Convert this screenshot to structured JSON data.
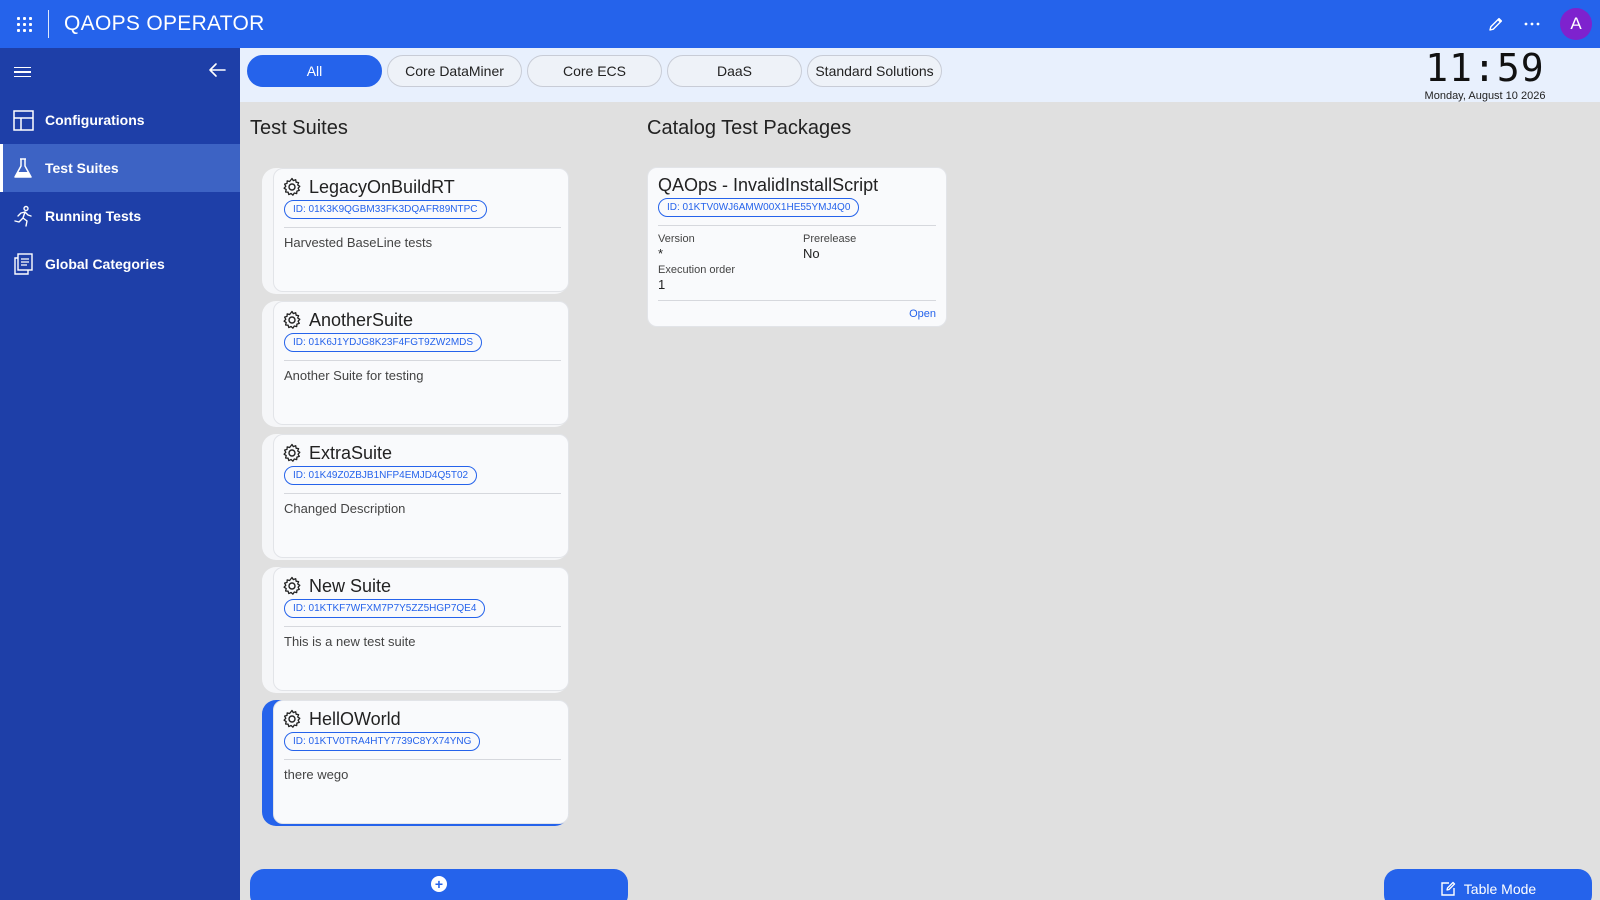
{
  "topbar": {
    "title": "QAOPS OPERATOR",
    "avatar_initial": "A",
    "icons": [
      "apps-icon",
      "edit-icon",
      "more-icon"
    ]
  },
  "sidebar": {
    "items": [
      {
        "label": "Configurations",
        "icon": "layout-icon",
        "active": false
      },
      {
        "label": "Test Suites",
        "icon": "flask-icon",
        "active": true
      },
      {
        "label": "Running Tests",
        "icon": "running-icon",
        "active": false
      },
      {
        "label": "Global Categories",
        "icon": "documents-icon",
        "active": false
      }
    ]
  },
  "filters": {
    "chips": [
      "All",
      "Core DataMiner",
      "Core ECS",
      "DaaS",
      "Standard Solutions"
    ],
    "selected": "All"
  },
  "clock": {
    "time": "11:59",
    "date": "Monday, August 10 2026"
  },
  "suites_section": {
    "title": "Test Suites",
    "cards": [
      {
        "name": "LegacyOnBuildRT",
        "id": "ID: 01K3K9QGBM33FK3DQAFR89NTPC",
        "description": "Harvested BaseLine tests"
      },
      {
        "name": "AnotherSuite",
        "id": "ID: 01K6J1YDJG8K23F4FGT9ZW2MDS",
        "description": "Another Suite for testing"
      },
      {
        "name": "ExtraSuite",
        "id": "ID: 01K49Z0ZBJB1NFP4EMJD4Q5T02",
        "description": "Changed Description"
      },
      {
        "name": "New Suite",
        "id": "ID: 01KTKF7WFXM7P7Y5ZZ5HGP7QE4",
        "description": "This is a new test suite"
      },
      {
        "name": "HellOWorld",
        "id": "ID: 01KTV0TRA4HTY7739C8YX74YNG",
        "description": "there wego"
      }
    ],
    "selected_index": 4
  },
  "packages_section": {
    "title": "Catalog Test Packages",
    "card": {
      "name": "QAOps - InvalidInstallScript",
      "id": "ID: 01KTV0WJ6AMW00X1HE55YMJ4Q0",
      "version_label": "Version",
      "version_value": "*",
      "prerelease_label": "Prerelease",
      "prerelease_value": "No",
      "execution_order_label": "Execution order",
      "execution_order_value": "1",
      "open_label": "Open"
    }
  },
  "actions": {
    "add_icon": "plus-circle-icon",
    "table_mode_label": "Table Mode"
  },
  "colors": {
    "accent": "#2563eb",
    "sidebar": "#1e3fa8",
    "sidebar_active": "#3d63c4",
    "avatar": "#7e22ce",
    "background": "#e0e0e0"
  }
}
